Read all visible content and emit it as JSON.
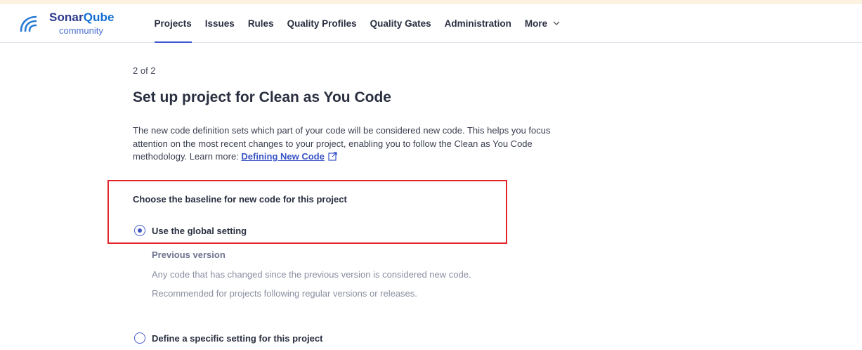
{
  "logo": {
    "brand_pre": "Sonar",
    "brand_post": "Qube",
    "edition": "community"
  },
  "nav": {
    "items": [
      {
        "label": "Projects",
        "active": true
      },
      {
        "label": "Issues"
      },
      {
        "label": "Rules"
      },
      {
        "label": "Quality Profiles"
      },
      {
        "label": "Quality Gates"
      },
      {
        "label": "Administration"
      }
    ],
    "more_label": "More"
  },
  "page": {
    "step": "2 of 2",
    "title": "Set up project for Clean as You Code",
    "intro_text": "The new code definition sets which part of your code will be considered new code. This helps you focus attention on the most recent changes to your project, enabling you to follow the Clean as You Code methodology. Learn more: ",
    "intro_link": "Defining New Code"
  },
  "baseline": {
    "label": "Choose the baseline for new code for this project",
    "options": [
      {
        "label": "Use the global setting",
        "checked": true
      },
      {
        "label": "Define a specific setting for this project",
        "checked": false
      }
    ],
    "global": {
      "title": "Previous version",
      "desc1": "Any code that has changed since the previous version is considered new code.",
      "desc2": "Recommended for projects following regular versions or releases."
    }
  },
  "colors": {
    "accent": "#4056cf",
    "highlight": "#e2242b",
    "topstrip": "#fbf3df"
  }
}
